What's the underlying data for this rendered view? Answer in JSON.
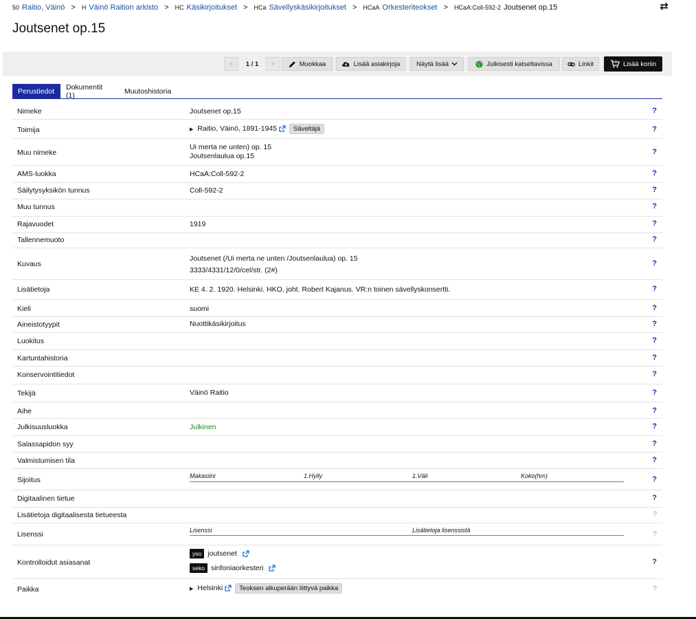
{
  "breadcrumb": [
    {
      "code": "50",
      "label": "Raitio, Väinö"
    },
    {
      "code": "H",
      "label": "Väinö Raition arkisto"
    },
    {
      "code": "HC",
      "label": "Käsikirjoitukset"
    },
    {
      "code": "HCa",
      "label": "Sävellyskäsikirjoitukset"
    },
    {
      "code": "HCaA",
      "label": "Orkesteriteokset"
    },
    {
      "code": "HCaA:Coll-592-2",
      "label": "Joutsenet op.15"
    }
  ],
  "page_title": "Joutsenet op.15",
  "toolbar": {
    "pagination": "1 / 1",
    "edit": "Muokkaa",
    "add_docs": "Lisää asiakirjoja",
    "show_more": "Näytä lisää",
    "public_view": "Julkisesti katseltavissa",
    "links": "Linkit",
    "add_cart": "Lisää koriin"
  },
  "tabs": [
    "Perustiedot",
    "Dokumentit (1)",
    "Muutoshistoria"
  ],
  "fields": {
    "nimeke": {
      "label": "Nimeke",
      "value": "Joutsenet op.15"
    },
    "toimija": {
      "label": "Toimija",
      "value": "Raitio, Väinö, 1891-1945",
      "role": "Säveltäjä"
    },
    "muu_nimeke": {
      "label": "Muu nimeke",
      "value1": "Ui merta ne unten) op. 15",
      "value2": "Joutsenlaulua op.15"
    },
    "ams": {
      "label": "AMS-luokka",
      "value": "HCaA:Coll-592-2"
    },
    "sailytys": {
      "label": "Säilytysyksikön tunnus",
      "value": "Coll-592-2"
    },
    "muu_tunnus": {
      "label": "Muu tunnus"
    },
    "rajavuodet": {
      "label": "Rajavuodet",
      "value": "1919"
    },
    "tallennemuoto": {
      "label": "Tallennemuoto"
    },
    "kuvaus": {
      "label": "Kuvaus",
      "value1": "Joutsenet (/Ui merta ne unten /Joutsenlaulua) op. 15",
      "value2": "3333/4331/12/0/cel/str. (2#)"
    },
    "lisatietoja": {
      "label": "Lisätietoja",
      "value": "KE 4. 2. 1920. Helsinki. HKO, joht. Robert Kajanus. VR:n toinen sävellyskonsertti."
    },
    "kieli": {
      "label": "Kieli",
      "value": "suomi"
    },
    "aineisto": {
      "label": "Aineistotyypit",
      "value": "Nuottikäsikirjoitus"
    },
    "luokitus": {
      "label": "Luokitus"
    },
    "kartunta": {
      "label": "Kartuntahistoria"
    },
    "konservointi": {
      "label": "Konservointitiedot"
    },
    "tekija": {
      "label": "Tekijä",
      "value": "Väinö Raitio"
    },
    "aihe": {
      "label": "Aihe"
    },
    "julkisuus": {
      "label": "Julkisuusluokka",
      "value": "Julkinen"
    },
    "salassapito": {
      "label": "Salassapidon syy"
    },
    "valmistuminen": {
      "label": "Valmistumisen tila"
    },
    "sijoitus": {
      "label": "Sijoitus",
      "col1": "Makasiini",
      "col2": "1.Hylly",
      "col3": "1.Väli",
      "col4": "Koko(hm)"
    },
    "digitaalinen": {
      "label": "Digitaalinen tietue"
    },
    "lisatietoja_digi": {
      "label": "Lisätietoja digitaalisesta tietueesta"
    },
    "lisenssi": {
      "label": "Lisenssi",
      "col1": "Lisenssi",
      "col2": "Lisätietoja lisenssistä"
    },
    "asiasanat": {
      "label": "Kontrolloidut asiasanat",
      "tag1": "yso",
      "term1": "joutsenet",
      "tag2": "seko",
      "term2": "sinfoniaorkesteri"
    },
    "paikka": {
      "label": "Paikka",
      "value": "Helsinki",
      "role": "Teoksen alkuperään liittyvä paikka"
    }
  },
  "help": "?",
  "swap_glyph": "⇄",
  "colors": {
    "accent": "#1c2ba0",
    "link": "#1a4fa3",
    "public": "#1c8a1c"
  }
}
